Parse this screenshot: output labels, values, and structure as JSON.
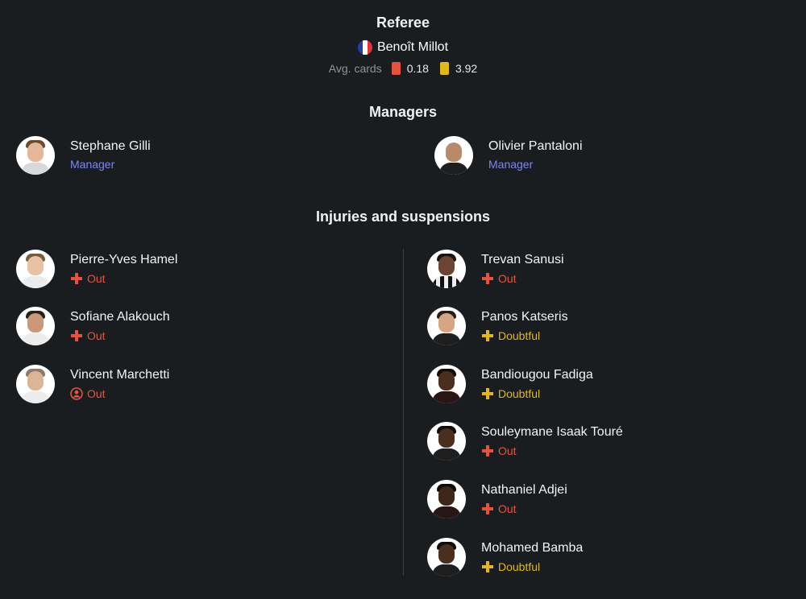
{
  "referee": {
    "title": "Referee",
    "name": "Benoît Millot",
    "avg_cards_label": "Avg. cards",
    "red_avg": "0.18",
    "yellow_avg": "3.92",
    "country_flag": "france-flag"
  },
  "managers": {
    "title": "Managers",
    "home": {
      "name": "Stephane Gilli",
      "role": "Manager"
    },
    "away": {
      "name": "Olivier Pantaloni",
      "role": "Manager"
    }
  },
  "injuries": {
    "title": "Injuries and suspensions",
    "home": [
      {
        "name": "Pierre-Yves Hamel",
        "status": "Out",
        "type": "injury"
      },
      {
        "name": "Sofiane Alakouch",
        "status": "Out",
        "type": "injury"
      },
      {
        "name": "Vincent Marchetti",
        "status": "Out",
        "type": "other"
      }
    ],
    "away": [
      {
        "name": "Trevan Sanusi",
        "status": "Out",
        "type": "injury"
      },
      {
        "name": "Panos Katseris",
        "status": "Doubtful",
        "type": "injury"
      },
      {
        "name": "Bandiougou Fadiga",
        "status": "Doubtful",
        "type": "injury"
      },
      {
        "name": "Souleymane Isaak Touré",
        "status": "Out",
        "type": "injury"
      },
      {
        "name": "Nathaniel Adjei",
        "status": "Out",
        "type": "injury"
      },
      {
        "name": "Mohamed Bamba",
        "status": "Doubtful",
        "type": "injury"
      }
    ]
  },
  "colors": {
    "background": "#1a1d1f",
    "out": "#e5533d",
    "doubtful": "#e3b71b",
    "manager_role": "#7d86f5",
    "red_card": "#e5533d",
    "yellow_card": "#e3b71b"
  }
}
